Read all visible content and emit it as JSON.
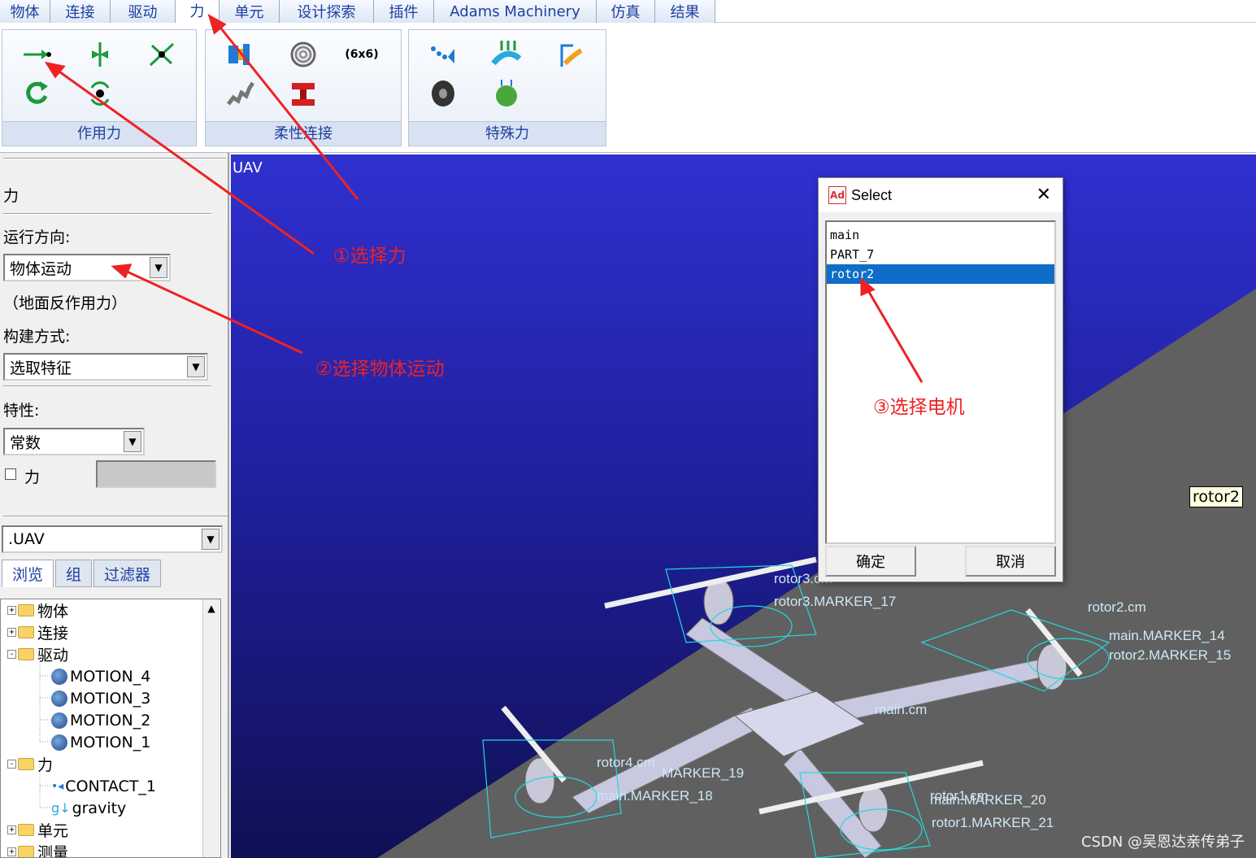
{
  "tabs": [
    "物体",
    "连接",
    "驱动",
    "力",
    "单元",
    "设计探索",
    "插件",
    "Adams Machinery",
    "仿真",
    "结果"
  ],
  "active_tab": "力",
  "ribbon": {
    "groups": [
      {
        "label": "作用力"
      },
      {
        "label": "柔性连接",
        "matrix_text": "(6x6)"
      },
      {
        "label": "特殊力"
      }
    ]
  },
  "panel": {
    "title": "力",
    "run_direction_label": "运行方向:",
    "run_direction_value": "物体运动",
    "reaction_note": "（地面反作用力）",
    "construct_label": "构建方式:",
    "construct_value": "选取特征",
    "property_label": "特性:",
    "property_value": "常数",
    "force_checkbox_label": "力"
  },
  "browser": {
    "model_value": ".UAV",
    "tabs": [
      "浏览",
      "组",
      "过滤器"
    ],
    "tree": [
      {
        "label": "物体",
        "level": 0,
        "expander": "+",
        "icon": "folder"
      },
      {
        "label": "连接",
        "level": 0,
        "expander": "+",
        "icon": "folder"
      },
      {
        "label": "驱动",
        "level": 0,
        "expander": "-",
        "icon": "folder"
      },
      {
        "label": "MOTION_4",
        "level": 1,
        "icon": "motion"
      },
      {
        "label": "MOTION_3",
        "level": 1,
        "icon": "motion"
      },
      {
        "label": "MOTION_2",
        "level": 1,
        "icon": "motion"
      },
      {
        "label": "MOTION_1",
        "level": 1,
        "icon": "motion"
      },
      {
        "label": "力",
        "level": 0,
        "expander": "-",
        "icon": "folder"
      },
      {
        "label": "CONTACT_1",
        "level": 1,
        "icon": "contact"
      },
      {
        "label": "gravity",
        "level": 1,
        "icon": "gravity"
      },
      {
        "label": "单元",
        "level": 0,
        "expander": "+",
        "icon": "folder"
      },
      {
        "label": "测量",
        "level": 0,
        "expander": "+",
        "icon": "folder"
      }
    ]
  },
  "viewport": {
    "title": "UAV",
    "hover_label": "rotor2",
    "marker_labels": [
      "rotor3.cm",
      "rotor3.MARKER_17",
      "rotor2.cm",
      "main.MARKER_14",
      "rotor2.MARKER_15",
      "main.cm",
      "rotor4.cm",
      "MARKER_19",
      "main.MARKER_18",
      "rotor1.cm",
      "main.MARKER_20",
      "rotor1.MARKER_21"
    ]
  },
  "dialog": {
    "title": "Select",
    "logo": "Ad",
    "items": [
      "main",
      "PART_7",
      "rotor2"
    ],
    "selected": "rotor2",
    "ok_label": "确定",
    "cancel_label": "取消"
  },
  "annotations": {
    "step1": "①选择力",
    "step2": "②选择物体运动",
    "step3": "③选择电机",
    "arrow_color": "#ee2222"
  },
  "watermark": "CSDN @吴恩达亲传弟子"
}
